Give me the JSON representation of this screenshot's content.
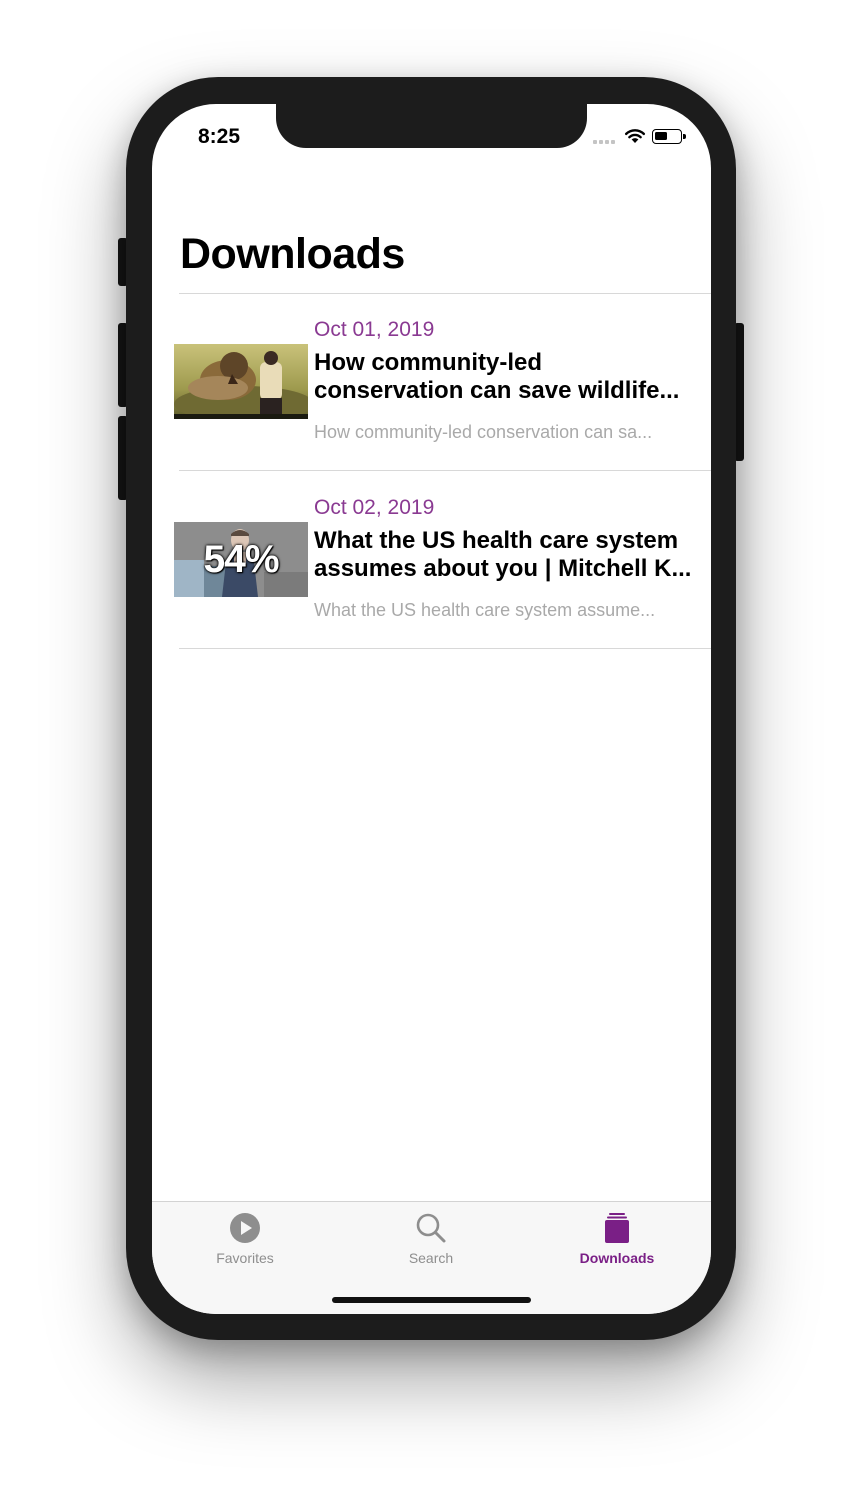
{
  "status_bar": {
    "time": "8:25"
  },
  "header": {
    "title": "Downloads"
  },
  "downloads": [
    {
      "date": "Oct 01, 2019",
      "title_line1": "How community-led",
      "title_line2": "conservation can save wildlife...",
      "subtitle": "How community-led conservation can sa...",
      "thumbnail": "lion-and-speaker-thumbnail"
    },
    {
      "date": "Oct 02, 2019",
      "title_line1": "What the US health care system",
      "title_line2": "assumes about you | Mitchell K...",
      "subtitle": "What the US health care system assume...",
      "thumbnail": "speaker-thumbnail",
      "progress_text": "54%",
      "progress": 0.54
    }
  ],
  "tabbar": {
    "tabs": [
      {
        "label": "Favorites",
        "icon": "play-circle-icon",
        "active": false
      },
      {
        "label": "Search",
        "icon": "magnifier-icon",
        "active": false
      },
      {
        "label": "Downloads",
        "icon": "downloads-stack-icon",
        "active": true
      }
    ]
  },
  "colors": {
    "accent": "#7a1f86",
    "date": "#8a3a92",
    "inactive_tab": "#8e8e8e"
  }
}
